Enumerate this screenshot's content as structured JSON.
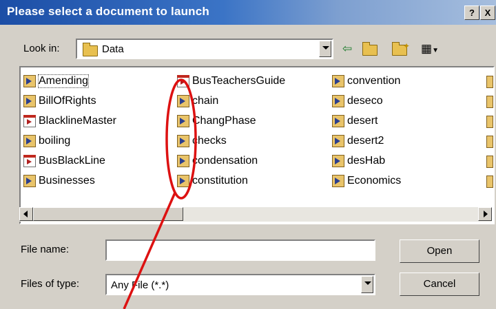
{
  "window": {
    "title": "Please select a document to launch",
    "help_label": "?",
    "close_label": "X"
  },
  "toolbar": {
    "lookin_label": "Look in:",
    "lookin_value": "Data",
    "back_icon": "⇦",
    "up_icon": "⬆",
    "new_folder_icon": "✦",
    "view_icon": "▦"
  },
  "files": {
    "col1": [
      "Amending",
      "BillOfRights",
      "BlacklineMaster",
      "boiling",
      "BusBlackLine",
      "Businesses"
    ],
    "col2": [
      "BusTeachersGuide",
      "chain",
      "ChangPhase",
      "checks",
      "condensation",
      "constitution"
    ],
    "col3": [
      "convention",
      "deseco",
      "desert",
      "desert2",
      "desHab",
      "Economics"
    ]
  },
  "form": {
    "filename_label": "File name:",
    "filename_value": "",
    "filetype_label": "Files of type:",
    "filetype_value": "Any File (*.*)",
    "open_label": "Open",
    "cancel_label": "Cancel"
  }
}
